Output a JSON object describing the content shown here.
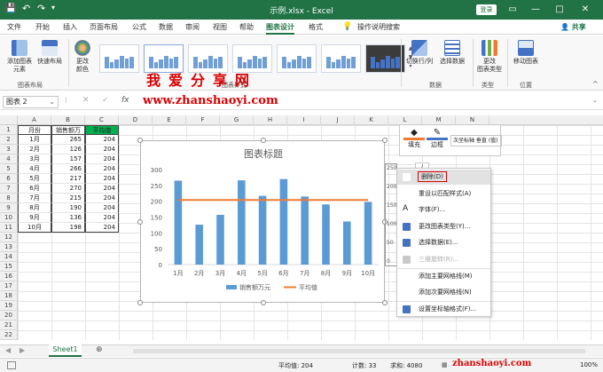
{
  "title": "示例.xlsx - Excel",
  "login": "登录",
  "share": "共享",
  "tabs": [
    "文件",
    "开始",
    "插入",
    "页面布局",
    "公式",
    "数据",
    "审阅",
    "视图",
    "帮助",
    "图表设计",
    "格式",
    "操作说明搜索"
  ],
  "active_tab": "图表设计",
  "ribbon": {
    "add_element": "添加图表\n元素",
    "quick_layout": "快速布局",
    "change_color": "更改\n颜色",
    "switch_row_col": "切换行/列",
    "select_data": "选择数据",
    "change_type": "更改\n图表类型",
    "move_chart": "移动图表",
    "group_layout": "图表布局",
    "group_styles": "图表样式",
    "group_data": "数据",
    "group_type": "类型",
    "group_location": "位置"
  },
  "watermark": {
    "big": "我爱分享网",
    "url": "www.zhanshaoyi.com"
  },
  "name_box": "图表 2",
  "fx": "fx",
  "columns": [
    "A",
    "B",
    "C",
    "D",
    "E",
    "F",
    "G",
    "H",
    "I",
    "J",
    "K",
    "L",
    "M",
    "N"
  ],
  "rows": [
    "1",
    "2",
    "3",
    "4",
    "5",
    "6",
    "7",
    "8",
    "9",
    "10",
    "11",
    "12",
    "13",
    "14",
    "15",
    "16",
    "17",
    "18",
    "19",
    "20",
    "21",
    "22"
  ],
  "table": {
    "headers": [
      "月份",
      "销售额万元",
      "平均值"
    ],
    "data": [
      [
        "1月",
        "265",
        "204"
      ],
      [
        "2月",
        "126",
        "204"
      ],
      [
        "3月",
        "157",
        "204"
      ],
      [
        "4月",
        "266",
        "204"
      ],
      [
        "5月",
        "217",
        "204"
      ],
      [
        "6月",
        "270",
        "204"
      ],
      [
        "7月",
        "215",
        "204"
      ],
      [
        "8月",
        "190",
        "204"
      ],
      [
        "9月",
        "136",
        "204"
      ],
      [
        "10月",
        "198",
        "204"
      ]
    ]
  },
  "chart_data": {
    "type": "bar",
    "title": "图表标题",
    "categories": [
      "1月",
      "2月",
      "3月",
      "4月",
      "5月",
      "6月",
      "7月",
      "8月",
      "9月",
      "10月"
    ],
    "series": [
      {
        "name": "销售额万元",
        "type": "bar",
        "values": [
          265,
          126,
          157,
          266,
          217,
          270,
          215,
          190,
          136,
          198
        ],
        "color": "#5b9bd5"
      },
      {
        "name": "平均值",
        "type": "line",
        "values": [
          204,
          204,
          204,
          204,
          204,
          204,
          204,
          204,
          204,
          204
        ],
        "color": "#ed7d31"
      }
    ],
    "ylim": [
      0,
      300
    ],
    "yticks": [
      "300",
      "250",
      "200",
      "150",
      "100",
      "50",
      "0"
    ],
    "y2ticks": [
      "250",
      "200",
      "150",
      "100",
      "50",
      "0"
    ],
    "legend": "bottom",
    "grid": false
  },
  "mini_toolbar": {
    "fill": "填充",
    "outline": "边框",
    "series_select": "次坐标轴 垂直 (值)"
  },
  "context_menu": [
    {
      "label": "删除(D)",
      "icon": "delete-icon",
      "highlight": true
    },
    {
      "label": "重设以匹配样式(A)",
      "icon": "reset-icon"
    },
    {
      "label": "字体(F)...",
      "icon": "font-icon"
    },
    {
      "label": "更改图表类型(Y)...",
      "icon": "chart-type-icon"
    },
    {
      "label": "选择数据(E)...",
      "icon": "select-data-icon"
    },
    {
      "label": "三维旋转(R)...",
      "icon": "rotate-3d-icon",
      "disabled": true
    },
    {
      "label": "添加主要网格线(M)",
      "icon": ""
    },
    {
      "label": "添加次要网格线(N)",
      "icon": ""
    },
    {
      "label": "设置坐标轴格式(F)...",
      "icon": "format-axis-icon"
    }
  ],
  "sheet_tab": "Sheet1",
  "status": {
    "average": "平均值: 204",
    "count": "计数: 33",
    "sum": "求和: 4080",
    "zoom": "100%"
  },
  "bottom_watermark": "zhanshaoyi.com",
  "colors": {
    "excel_green": "#217346",
    "avg_fill": "#00b050",
    "red": "#d90000"
  }
}
